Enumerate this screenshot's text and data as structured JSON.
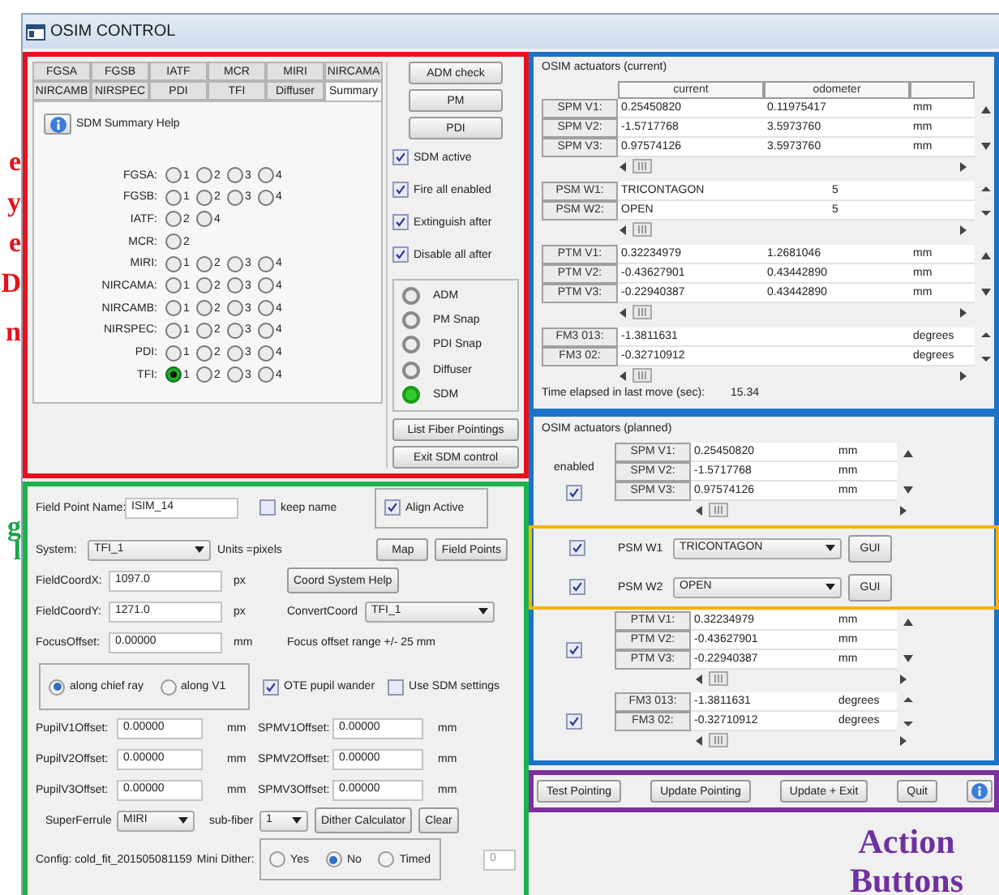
{
  "side_annotations": [
    {
      "text": "e",
      "color": "#e3141b"
    },
    {
      "text": "y",
      "color": "#e3141b"
    },
    {
      "text": "e",
      "color": "#e3141b"
    },
    {
      "text": "D",
      "color": "#e3141b"
    },
    {
      "text": "n",
      "color": "#e3141b"
    },
    {
      "text": "g",
      "color": "#1aa34a"
    },
    {
      "text": "l",
      "color": "#1aa34a"
    }
  ],
  "window": {
    "title": "OSIM CONTROL"
  },
  "sdm": {
    "tab_rows": [
      [
        {
          "label": "FGSA",
          "selected": false
        },
        {
          "label": "FGSB",
          "selected": false
        },
        {
          "label": "IATF",
          "selected": false
        },
        {
          "label": "MCR",
          "selected": false
        },
        {
          "label": "MIRI",
          "selected": false
        },
        {
          "label": "NIRCAMA",
          "selected": false
        }
      ],
      [
        {
          "label": "NIRCAMB",
          "selected": false
        },
        {
          "label": "NIRSPEC",
          "selected": false
        },
        {
          "label": "PDI",
          "selected": false
        },
        {
          "label": "TFI",
          "selected": false
        },
        {
          "label": "Diffuser",
          "selected": false
        },
        {
          "label": "Summary",
          "selected": true
        }
      ]
    ],
    "help_label": "SDM Summary Help",
    "instruments": [
      {
        "label": "FGSA:",
        "options": [
          {
            "label": "1",
            "selected": false
          },
          {
            "label": "2",
            "selected": false
          },
          {
            "label": "3",
            "selected": false
          },
          {
            "label": "4",
            "selected": false
          }
        ]
      },
      {
        "label": "FGSB:",
        "options": [
          {
            "label": "1",
            "selected": false
          },
          {
            "label": "2",
            "selected": false
          },
          {
            "label": "3",
            "selected": false
          },
          {
            "label": "4",
            "selected": false
          }
        ]
      },
      {
        "label": "IATF:",
        "options": [
          {
            "label": "2",
            "selected": false
          },
          {
            "label": "4",
            "selected": false
          }
        ]
      },
      {
        "label": "MCR:",
        "options": [
          {
            "label": "2",
            "selected": false
          }
        ]
      },
      {
        "label": "MIRI:",
        "options": [
          {
            "label": "1",
            "selected": false
          },
          {
            "label": "2",
            "selected": false
          },
          {
            "label": "3",
            "selected": false
          },
          {
            "label": "4",
            "selected": false
          }
        ]
      },
      {
        "label": "NIRCAMA:",
        "options": [
          {
            "label": "1",
            "selected": false
          },
          {
            "label": "2",
            "selected": false
          },
          {
            "label": "3",
            "selected": false
          },
          {
            "label": "4",
            "selected": false
          }
        ]
      },
      {
        "label": "NIRCAMB:",
        "options": [
          {
            "label": "1",
            "selected": false
          },
          {
            "label": "2",
            "selected": false
          },
          {
            "label": "3",
            "selected": false
          },
          {
            "label": "4",
            "selected": false
          }
        ]
      },
      {
        "label": "NIRSPEC:",
        "options": [
          {
            "label": "1",
            "selected": false
          },
          {
            "label": "2",
            "selected": false
          },
          {
            "label": "3",
            "selected": false
          },
          {
            "label": "4",
            "selected": false
          }
        ]
      },
      {
        "label": "PDI:",
        "options": [
          {
            "label": "1",
            "selected": false
          },
          {
            "label": "2",
            "selected": false
          },
          {
            "label": "3",
            "selected": false
          },
          {
            "label": "4",
            "selected": false
          }
        ]
      },
      {
        "label": "TFI:",
        "options": [
          {
            "label": "1",
            "selected": true
          },
          {
            "label": "2",
            "selected": false
          },
          {
            "label": "3",
            "selected": false
          },
          {
            "label": "4",
            "selected": false
          }
        ]
      }
    ],
    "buttons": [
      "ADM check",
      "PM",
      "PDI"
    ],
    "checks": [
      {
        "label": "SDM active",
        "checked": true
      },
      {
        "label": "Fire all enabled",
        "checked": true
      },
      {
        "label": "Extinguish after",
        "checked": true
      },
      {
        "label": "Disable all after",
        "checked": true
      }
    ],
    "indicators": [
      {
        "label": "ADM",
        "on": false
      },
      {
        "label": "PM Snap",
        "on": false
      },
      {
        "label": "PDI Snap",
        "on": false
      },
      {
        "label": "Diffuser",
        "on": false
      },
      {
        "label": "SDM",
        "on": true
      }
    ],
    "footer_buttons": [
      "List Fiber Pointings",
      "Exit SDM control"
    ]
  },
  "pointing": {
    "field_point_name": {
      "label": "Field Point Name:",
      "value": "ISIM_14"
    },
    "keep_name": {
      "label": "keep name",
      "checked": false
    },
    "align_active": {
      "label": "Align Active",
      "checked": true
    },
    "system": {
      "label": "System:",
      "value": "TFI_1",
      "units": "Units =pixels"
    },
    "map_buttons": [
      "Map",
      "Field Points"
    ],
    "coord_x": {
      "label": "FieldCoordX:",
      "value": "1097.0",
      "unit": "px"
    },
    "coord_help": "Coord System Help",
    "coord_y": {
      "label": "FieldCoordY:",
      "value": "1271.0",
      "unit": "px"
    },
    "convert": {
      "label": "ConvertCoord",
      "value": "TFI_1"
    },
    "focus": {
      "label": "FocusOffset:",
      "value": "0.00000",
      "unit": "mm"
    },
    "focus_note": "Focus offset range +/- 25 mm",
    "direction": [
      {
        "label": "along chief ray",
        "selected": true
      },
      {
        "label": "along V1",
        "selected": false
      }
    ],
    "options": [
      {
        "label": "OTE pupil wander",
        "checked": true
      },
      {
        "label": "Use SDM settings",
        "checked": false
      }
    ],
    "offsets": [
      {
        "pupil_label": "PupilV1Offset:",
        "pupil_value": "0.00000",
        "pupil_unit": "mm",
        "spm_label": "SPMV1Offset:",
        "spm_value": "0.00000",
        "spm_unit": "mm"
      },
      {
        "pupil_label": "PupilV2Offset:",
        "pupil_value": "0.00000",
        "pupil_unit": "mm",
        "spm_label": "SPMV2Offset:",
        "spm_value": "0.00000",
        "spm_unit": "mm"
      },
      {
        "pupil_label": "PupilV3Offset:",
        "pupil_value": "0.00000",
        "pupil_unit": "mm",
        "spm_label": "SPMV3Offset:",
        "spm_value": "0.00000",
        "spm_unit": "mm"
      }
    ],
    "superferrule": {
      "label": "SuperFerrule",
      "value": "MIRI"
    },
    "subfiber": {
      "label": "sub-fiber",
      "value": "1"
    },
    "tool_buttons": [
      "Dither Calculator",
      "Clear"
    ],
    "config": "Config: cold_fit_201505081159",
    "mini_dither": {
      "label": "Mini Dither:",
      "options": [
        {
          "label": "Yes",
          "selected": false
        },
        {
          "label": "No",
          "selected": true
        },
        {
          "label": "Timed",
          "selected": false
        }
      ]
    },
    "count": "0"
  },
  "current": {
    "title": "OSIM actuators (current)",
    "columns": [
      "current",
      "odometer"
    ],
    "groups": [
      {
        "kind": "numeric",
        "rows": [
          {
            "name": "SPM V1:",
            "current": "0.25450820",
            "odometer": "0.11975417",
            "unit": "mm"
          },
          {
            "name": "SPM V2:",
            "current": "-1.5717768",
            "odometer": "3.5973760",
            "unit": "mm"
          },
          {
            "name": "SPM V3:",
            "current": "0.97574126",
            "odometer": "3.5973760",
            "unit": "mm"
          }
        ]
      },
      {
        "kind": "text",
        "rows": [
          {
            "name": "PSM W1:",
            "current": "TRICONTAGON",
            "odometer": "5"
          },
          {
            "name": "PSM W2:",
            "current": "OPEN",
            "odometer": "5"
          }
        ]
      },
      {
        "kind": "numeric",
        "rows": [
          {
            "name": "PTM V1:",
            "current": "0.32234979",
            "odometer": "1.2681046",
            "unit": "mm"
          },
          {
            "name": "PTM V2:",
            "current": "-0.43627901",
            "odometer": "0.43442890",
            "unit": "mm"
          },
          {
            "name": "PTM V3:",
            "current": "-0.22940387",
            "odometer": "0.43442890",
            "unit": "mm"
          }
        ]
      },
      {
        "kind": "numeric",
        "rows": [
          {
            "name": "FM3 013:",
            "current": "-1.3811631",
            "unit": "degrees"
          },
          {
            "name": "FM3 02:",
            "current": "-0.32710912",
            "unit": "degrees"
          }
        ]
      }
    ],
    "elapsed": {
      "label": "Time elapsed in last move (sec):",
      "value": "15.34"
    }
  },
  "planned": {
    "title": "OSIM actuators (planned)",
    "enabled_label": "enabled",
    "groups": [
      {
        "kind": "table",
        "enabled": true,
        "rows": [
          {
            "name": "SPM V1:",
            "value": "0.25450820",
            "unit": "mm"
          },
          {
            "name": "SPM V2:",
            "value": "-1.5717768",
            "unit": "mm"
          },
          {
            "name": "SPM V3:",
            "value": "0.97574126",
            "unit": "mm"
          }
        ]
      },
      {
        "kind": "select",
        "enabled": true,
        "label": "PSM W1",
        "value": "TRICONTAGON",
        "button": "GUI"
      },
      {
        "kind": "select",
        "enabled": true,
        "label": "PSM W2",
        "value": "OPEN",
        "button": "GUI"
      },
      {
        "kind": "table",
        "enabled": true,
        "rows": [
          {
            "name": "PTM V1:",
            "value": "0.32234979",
            "unit": "mm"
          },
          {
            "name": "PTM V2:",
            "value": "-0.43627901",
            "unit": "mm"
          },
          {
            "name": "PTM V3:",
            "value": "-0.22940387",
            "unit": "mm"
          }
        ]
      },
      {
        "kind": "table",
        "enabled": true,
        "rows": [
          {
            "name": "FM3 013:",
            "value": "-1.3811631",
            "unit": "degrees"
          },
          {
            "name": "FM3 02:",
            "value": "-0.32710912",
            "unit": "degrees"
          }
        ]
      }
    ]
  },
  "action_buttons": [
    "Test Pointing",
    "Update Pointing",
    "Update + Exit",
    "Quit"
  ],
  "action_annotation": {
    "text": "Action Buttons",
    "color": "#7030a0"
  }
}
